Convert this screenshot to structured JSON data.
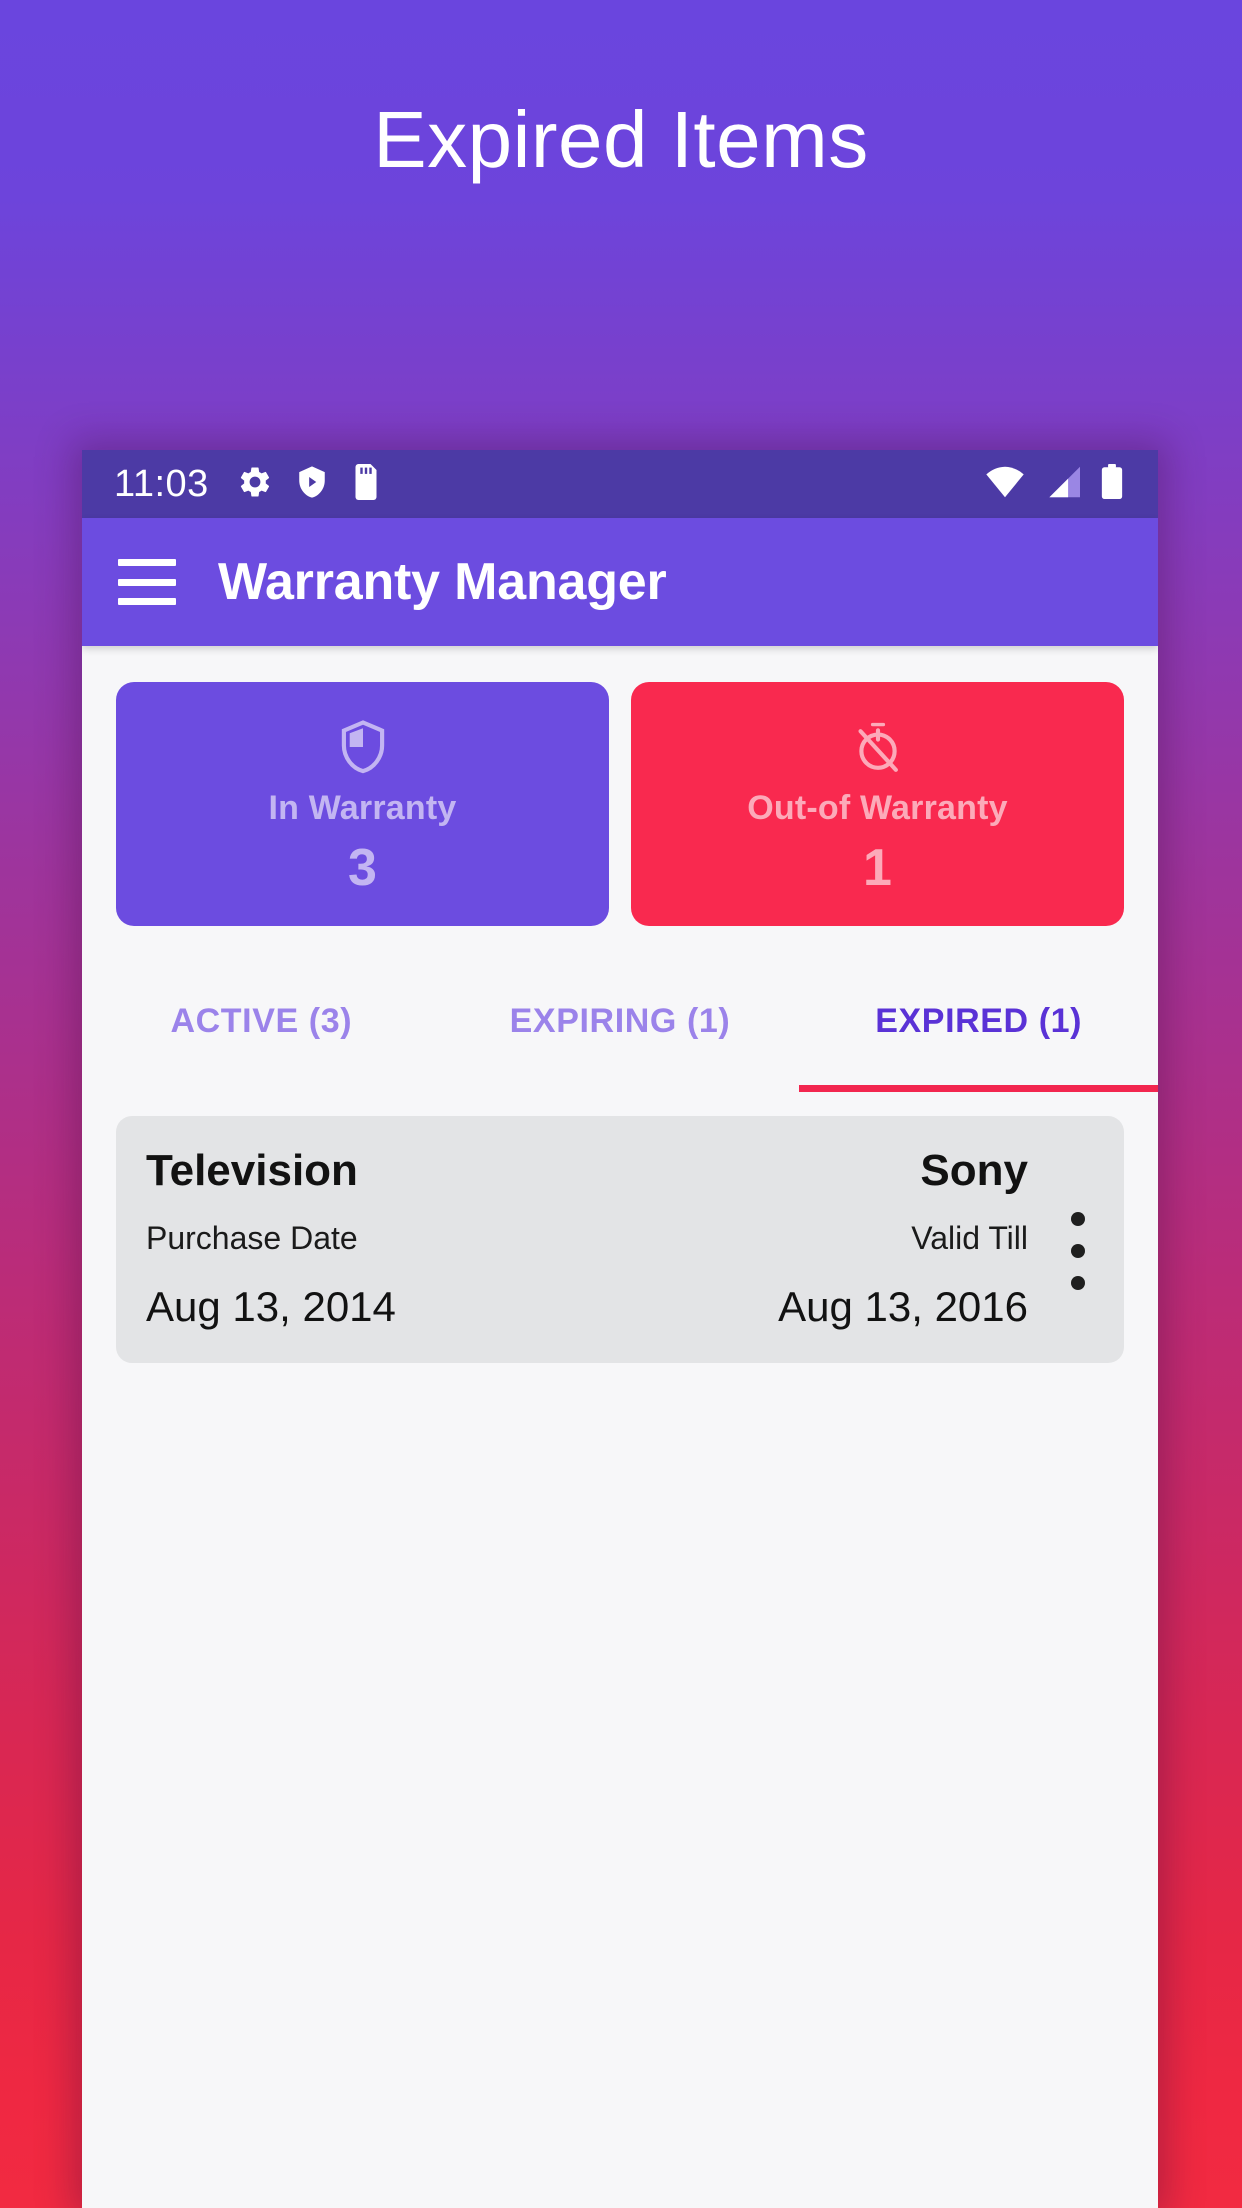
{
  "promo": {
    "title": "Expired Items"
  },
  "colors": {
    "bg_gradient_start": "#6a45de",
    "bg_gradient_end": "#f22a41",
    "appbar": "#6c4ce0",
    "statusbar": "#4c3aa5",
    "accent_purple": "#5a32d6",
    "accent_red": "#f2264f",
    "card_purple": "#6c4ce0",
    "card_red": "#f9294f",
    "list_card_bg": "#e3e4e6",
    "screen_bg": "#f7f7f9"
  },
  "statusbar": {
    "time": "11:03",
    "left_icons": [
      "gear-icon",
      "play-protect-shield-icon",
      "sd-card-icon"
    ],
    "right_icons": [
      "wifi-icon",
      "cellular-signal-icon",
      "battery-icon"
    ]
  },
  "appbar": {
    "menu_icon": "hamburger-menu-icon",
    "title": "Warranty Manager"
  },
  "summary_cards": [
    {
      "icon": "shield-icon",
      "label": "In Warranty",
      "count": "3",
      "color": "#6c4ce0"
    },
    {
      "icon": "timer-off-icon",
      "label": "Out-of Warranty",
      "count": "1",
      "color": "#f9294f"
    }
  ],
  "tabs": [
    {
      "label": "ACTIVE (3)",
      "active": false
    },
    {
      "label": "EXPIRING (1)",
      "active": false
    },
    {
      "label": "EXPIRED (1)",
      "active": true
    }
  ],
  "list": {
    "items": [
      {
        "name": "Television",
        "brand": "Sony",
        "purchase_label": "Purchase Date",
        "valid_label": "Valid Till",
        "purchase_date": "Aug 13, 2014",
        "valid_till": "Aug 13, 2016",
        "overflow_icon": "more-vertical-icon"
      }
    ]
  }
}
